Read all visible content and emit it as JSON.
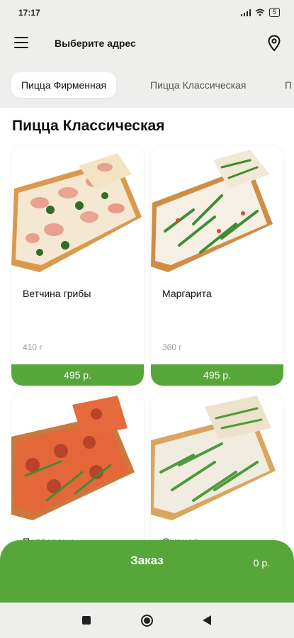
{
  "status": {
    "time": "17:17",
    "battery": "5"
  },
  "header": {
    "address": "Выберите адрес"
  },
  "tabs": [
    {
      "label": "Пицца Фирменная",
      "active": true
    },
    {
      "label": "Пицца Классическая",
      "active": false
    },
    {
      "label": "П",
      "active": false
    }
  ],
  "section": {
    "title": "Пицца Классическая"
  },
  "products": [
    {
      "name": "Ветчина грибы",
      "weight": "410 г",
      "price": "495 р."
    },
    {
      "name": "Маргарита",
      "weight": "360 г",
      "price": "495 р."
    },
    {
      "name": "Пепперони",
      "weight": "",
      "price": ""
    },
    {
      "name": "Сырная",
      "weight": "",
      "price": ""
    }
  ],
  "order": {
    "label": "Заказ",
    "total": "0 р."
  },
  "colors": {
    "accent": "#57a639",
    "background": "#eeeeec"
  },
  "icons": [
    "menu-icon",
    "location-pin-icon",
    "do-not-disturb-icon",
    "signal-icon",
    "wifi-icon",
    "battery-icon"
  ]
}
